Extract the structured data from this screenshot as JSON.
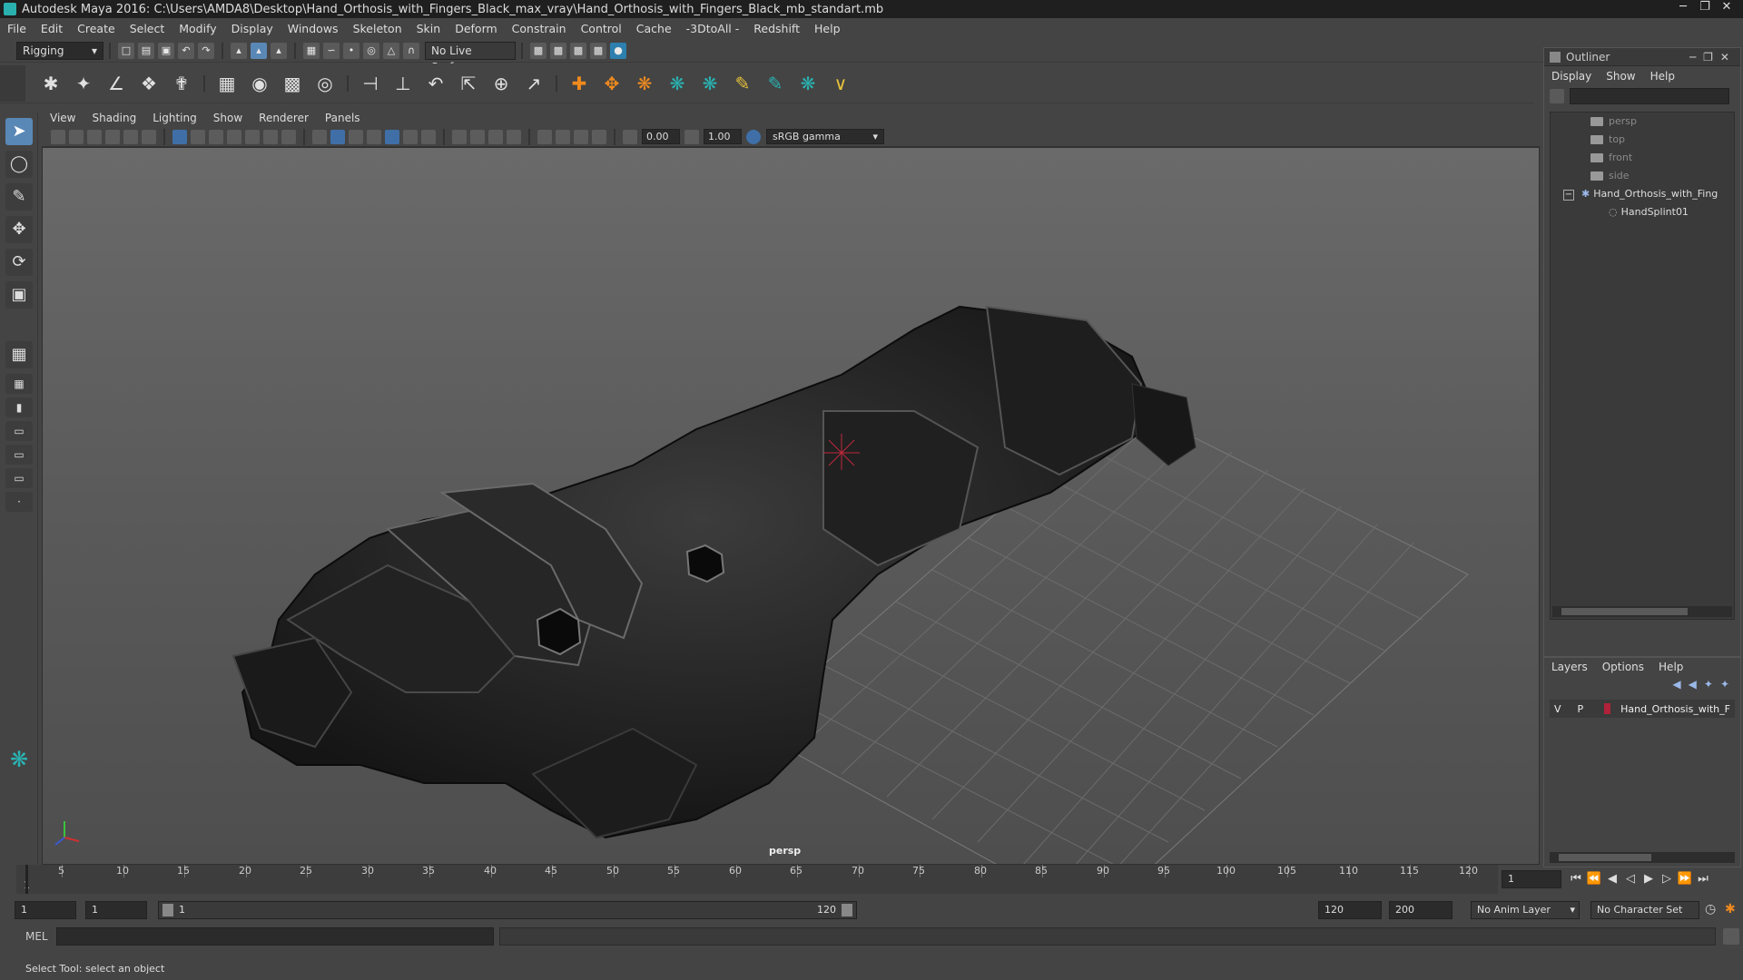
{
  "window": {
    "title": "Autodesk Maya 2016: C:\\Users\\AMDA8\\Desktop\\Hand_Orthosis_with_Fingers_Black_max_vray\\Hand_Orthosis_with_Fingers_Black_mb_standart.mb"
  },
  "menubar": [
    "File",
    "Edit",
    "Create",
    "Select",
    "Modify",
    "Display",
    "Windows",
    "Skeleton",
    "Skin",
    "Deform",
    "Constrain",
    "Control",
    "Cache",
    "-3DtoAll -",
    "Redshift",
    "Help"
  ],
  "statusline": {
    "mode": "Rigging",
    "live_surface": "No Live Surface"
  },
  "viewport": {
    "menu": [
      "View",
      "Shading",
      "Lighting",
      "Show",
      "Renderer",
      "Panels"
    ],
    "exposure": "0.00",
    "gamma": "1.00",
    "color_space": "sRGB gamma",
    "camera_label": "persp"
  },
  "outliner": {
    "title": "Outliner",
    "menu": [
      "Display",
      "Show",
      "Help"
    ],
    "nodes": [
      "persp",
      "top",
      "front",
      "side",
      "Hand_Orthosis_with_Fing",
      "HandSplint01"
    ]
  },
  "layers": {
    "menu": [
      "Layers",
      "Options",
      "Help"
    ],
    "row": {
      "v": "V",
      "p": "P",
      "name": "Hand_Orthosis_with_F",
      "color": "#b0223a"
    }
  },
  "timeline": {
    "ticks": [
      "5",
      "10",
      "15",
      "20",
      "25",
      "30",
      "35",
      "40",
      "45",
      "50",
      "55",
      "60",
      "65",
      "70",
      "75",
      "80",
      "85",
      "90",
      "95",
      "100",
      "105",
      "110",
      "115",
      "120"
    ],
    "current_frame": "1",
    "first_tick": "1"
  },
  "range": {
    "start": "1",
    "playback_start": "1",
    "slider_start": "1",
    "slider_end": "120",
    "playback_end": "120",
    "end": "200",
    "anim_layer": "No Anim Layer",
    "character_set": "No Character Set"
  },
  "cmdline": {
    "label": "MEL"
  },
  "help_line": "Select Tool: select an object",
  "colors": {
    "accent": "#5a88b6",
    "maya_teal": "#2ab3b3",
    "shelf_orange": "#f08a1e"
  }
}
